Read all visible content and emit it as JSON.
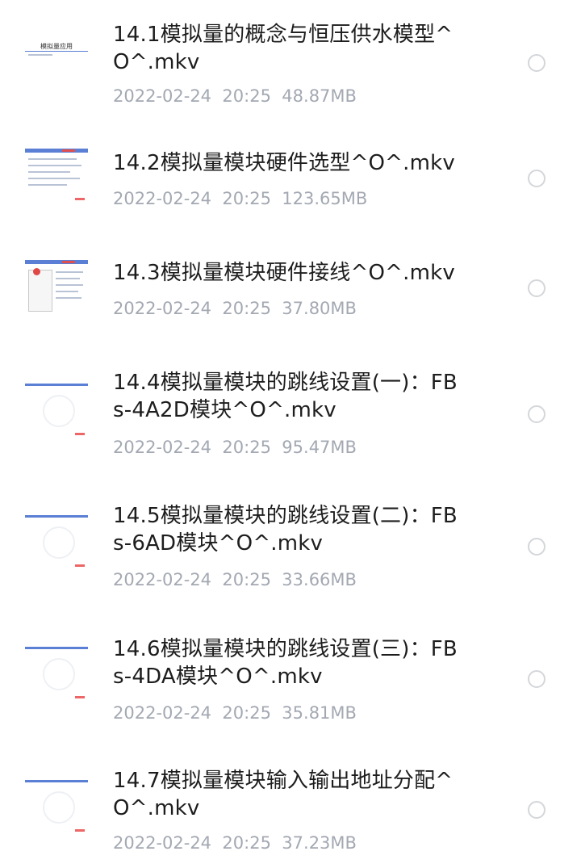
{
  "files": [
    {
      "name": "14.1模拟量的概念与恒压供水模型^O^.mkv",
      "date": "2022-02-24",
      "time": "20:25",
      "size": "48.87MB",
      "thumb_caption": "模拟量应用",
      "thumb_kind": "title",
      "selected": false
    },
    {
      "name": "14.2模拟量模块硬件选型^O^.mkv",
      "date": "2022-02-24",
      "time": "20:25",
      "size": "123.65MB",
      "thumb_kind": "text",
      "selected": false
    },
    {
      "name": "14.3模拟量模块硬件接线^O^.mkv",
      "date": "2022-02-24",
      "time": "20:25",
      "size": "37.80MB",
      "thumb_kind": "diagram",
      "selected": false
    },
    {
      "name": "14.4模拟量模块的跳线设置(一)：FBs-4A2D模块^O^.mkv",
      "date": "2022-02-24",
      "time": "20:25",
      "size": "95.47MB",
      "thumb_kind": "logo",
      "selected": false
    },
    {
      "name": "14.5模拟量模块的跳线设置(二)：FBs-6AD模块^O^.mkv",
      "date": "2022-02-24",
      "time": "20:25",
      "size": "33.66MB",
      "thumb_kind": "logo",
      "selected": false
    },
    {
      "name": "14.6模拟量模块的跳线设置(三)：FBs-4DA模块^O^.mkv",
      "date": "2022-02-24",
      "time": "20:25",
      "size": "35.81MB",
      "thumb_kind": "logo",
      "selected": false
    },
    {
      "name": "14.7模拟量模块输入输出地址分配^O^.mkv",
      "date": "2022-02-24",
      "time": "20:25",
      "size": "37.23MB",
      "thumb_kind": "logo",
      "selected": false
    }
  ],
  "colors": {
    "title_text": "#1d1d1d",
    "meta_text": "#a3a8b2",
    "radio_border": "#d4d6da",
    "thumb_bar": "#5b7fd4"
  }
}
